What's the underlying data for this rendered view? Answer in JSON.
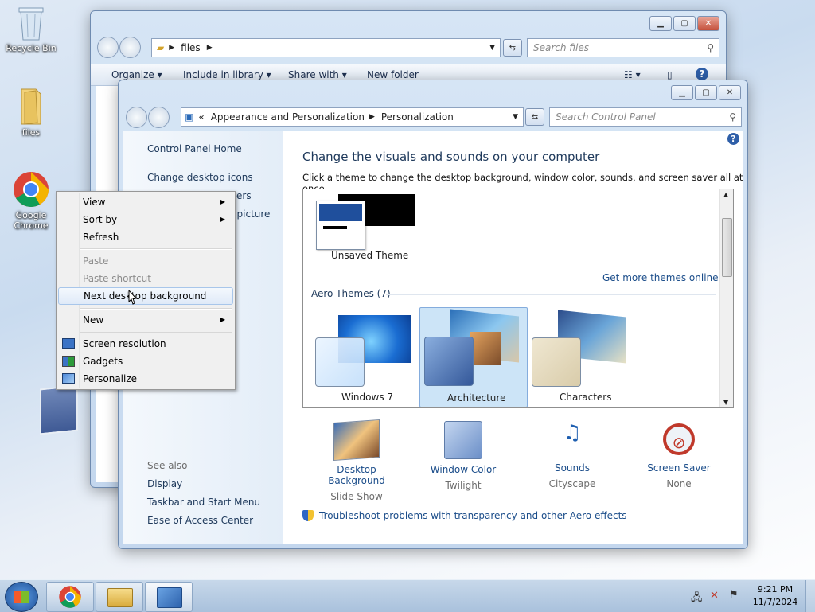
{
  "desktop": {
    "icons": [
      {
        "label": "Recycle Bin"
      },
      {
        "label": "files"
      },
      {
        "label": "Google Chrome"
      }
    ]
  },
  "explorer": {
    "address": "files",
    "search_placeholder": "Search files",
    "toolbar": {
      "organize": "Organize",
      "include_in_library": "Include in library",
      "share_with": "Share with",
      "new_folder": "New folder"
    }
  },
  "control_panel": {
    "address": {
      "prefix": "«",
      "part1": "Appearance and Personalization",
      "part2": "Personalization"
    },
    "search_placeholder": "Search Control Panel",
    "sidebar": {
      "home": "Control Panel Home",
      "desktop_icons": "Change desktop icons",
      "mouse_pointers_partial": "ers",
      "account_picture_partial": "t picture",
      "see_also": "See also",
      "display": "Display",
      "taskbar": "Taskbar and Start Menu",
      "ease": "Ease of Access Center"
    },
    "heading": "Change the visuals and sounds on your computer",
    "subheading": "Click a theme to change the desktop background, window color, sounds, and screen saver all at once.",
    "unsaved_theme": "Unsaved Theme",
    "get_more_themes": "Get more themes online",
    "aero_themes": "Aero Themes (7)",
    "themes": [
      {
        "label": "Windows 7"
      },
      {
        "label": "Architecture"
      },
      {
        "label": "Characters"
      }
    ],
    "settings": [
      {
        "title": "Desktop Background",
        "value": "Slide Show"
      },
      {
        "title": "Window Color",
        "value": "Twilight"
      },
      {
        "title": "Sounds",
        "value": "Cityscape"
      },
      {
        "title": "Screen Saver",
        "value": "None"
      }
    ],
    "troubleshoot": "Troubleshoot problems with transparency and other Aero effects"
  },
  "context_menu": {
    "view": "View",
    "sort_by": "Sort by",
    "refresh": "Refresh",
    "paste": "Paste",
    "paste_shortcut": "Paste shortcut",
    "next_background": "Next desktop background",
    "new": "New",
    "screen_resolution": "Screen resolution",
    "gadgets": "Gadgets",
    "personalize": "Personalize"
  },
  "taskbar": {
    "time": "9:21 PM",
    "date": "11/7/2024"
  },
  "colors": {
    "link": "#1b4d8a",
    "heading": "#1e395b",
    "selection": "#cce4f7"
  }
}
